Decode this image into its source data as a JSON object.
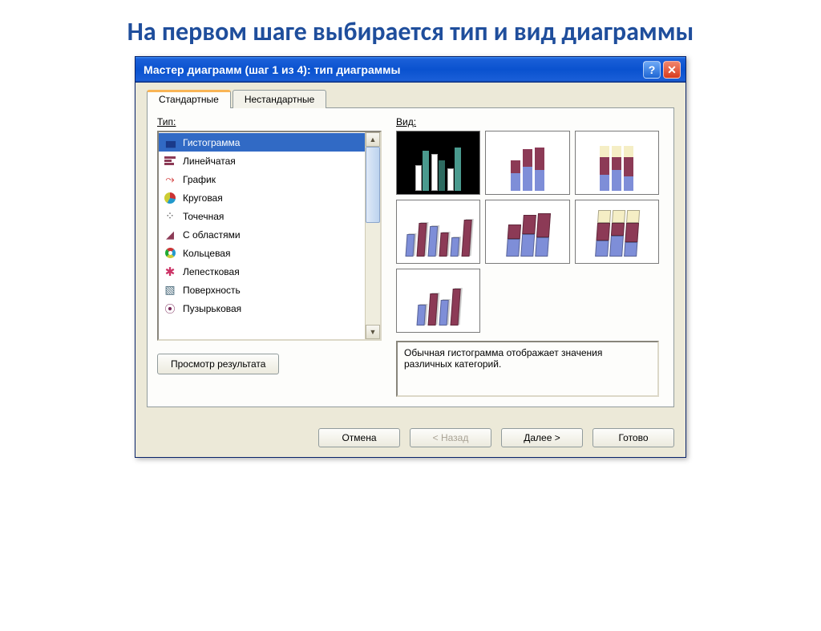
{
  "page": {
    "heading": "На первом шаге выбирается тип и вид диаграммы"
  },
  "window": {
    "title": "Мастер диаграмм (шаг 1 из 4): тип диаграммы"
  },
  "tabs": {
    "standard": "Стандартные",
    "custom": "Нестандартные"
  },
  "labels": {
    "type": "Тип:",
    "view": "Вид:",
    "preview": "Просмотр результата"
  },
  "type_list": [
    {
      "name": "Гистограмма",
      "icon": "bars",
      "selected": true
    },
    {
      "name": "Линейчатая",
      "icon": "hbar"
    },
    {
      "name": "График",
      "icon": "line"
    },
    {
      "name": "Круговая",
      "icon": "pie"
    },
    {
      "name": "Точечная",
      "icon": "scatter"
    },
    {
      "name": "С областями",
      "icon": "area"
    },
    {
      "name": "Кольцевая",
      "icon": "donut"
    },
    {
      "name": "Лепестковая",
      "icon": "radar"
    },
    {
      "name": "Поверхность",
      "icon": "surface"
    },
    {
      "name": "Пузырьковая",
      "icon": "bubble"
    }
  ],
  "description": "Обычная гистограмма отображает значения различных категорий.",
  "buttons": {
    "cancel": "Отмена",
    "back": "< Назад",
    "next": "Далее >",
    "finish": "Готово"
  },
  "colors": {
    "title_blue": "#1f4e9c",
    "xp_blue": "#0a52cf",
    "selection": "#316ac5",
    "bar_blue": "#7e8ed8",
    "bar_maroon": "#8c3a56",
    "bar_cream": "#f5eec5",
    "bar_teal": "#4a9a8e"
  },
  "chart_data": {
    "type": "bar",
    "note": "Seven chart-subtype preview thumbnails; no numeric axes shown, heights are illustrative only",
    "subtypes": [
      {
        "id": 1,
        "name": "clustered-column",
        "selected": true
      },
      {
        "id": 2,
        "name": "stacked-column"
      },
      {
        "id": 3,
        "name": "100pct-stacked-column"
      },
      {
        "id": 4,
        "name": "3d-clustered-column"
      },
      {
        "id": 5,
        "name": "3d-stacked-column"
      },
      {
        "id": 6,
        "name": "3d-100pct-stacked-column"
      },
      {
        "id": 7,
        "name": "3d-column"
      }
    ]
  }
}
